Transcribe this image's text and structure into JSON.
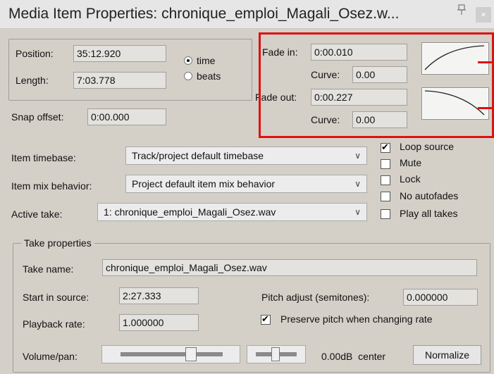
{
  "window": {
    "title": "Media Item Properties:  chronique_emploi_Magali_Osez.w...",
    "close_label": "×"
  },
  "position": {
    "position_label": "Position:",
    "position_value": "35:12.920",
    "length_label": "Length:",
    "length_value": "7:03.778",
    "time_label": "time",
    "beats_label": "beats",
    "time_selected": true,
    "snap_label": "Snap offset:",
    "snap_value": "0:00.000"
  },
  "fades": {
    "fade_in_label": "Fade in:",
    "fade_in_value": "0:00.010",
    "fade_in_curve_label": "Curve:",
    "fade_in_curve_value": "0.00",
    "fade_out_label": "Fade out:",
    "fade_out_value": "0:00.227",
    "fade_out_curve_label": "Curve:",
    "fade_out_curve_value": "0.00"
  },
  "item": {
    "timebase_label": "Item timebase:",
    "timebase_value": "Track/project default timebase",
    "mix_label": "Item mix behavior:",
    "mix_value": "Project default item mix behavior",
    "active_take_label": "Active take:",
    "active_take_value": "1: chronique_emploi_Magali_Osez.wav"
  },
  "options": [
    {
      "label": "Loop source",
      "checked": true
    },
    {
      "label": "Mute",
      "checked": false
    },
    {
      "label": "Lock",
      "checked": false
    },
    {
      "label": "No autofades",
      "checked": false
    },
    {
      "label": "Play all takes",
      "checked": false
    }
  ],
  "take": {
    "group_label": "Take properties",
    "name_label": "Take name:",
    "name_value": "chronique_emploi_Magali_Osez.wav",
    "start_label": "Start in source:",
    "start_value": "2:27.333",
    "pitch_label": "Pitch adjust (semitones):",
    "pitch_value": "0.000000",
    "rate_label": "Playback rate:",
    "rate_value": "1.000000",
    "preserve_label": "Preserve pitch when changing rate",
    "preserve_checked": true,
    "volpan_label": "Volume/pan:",
    "vol_display": "0.00dB  center",
    "normalize_label": "Normalize"
  },
  "colors": {
    "annotation_red": "#e01010",
    "dialog_bg": "#d4d0c8"
  }
}
